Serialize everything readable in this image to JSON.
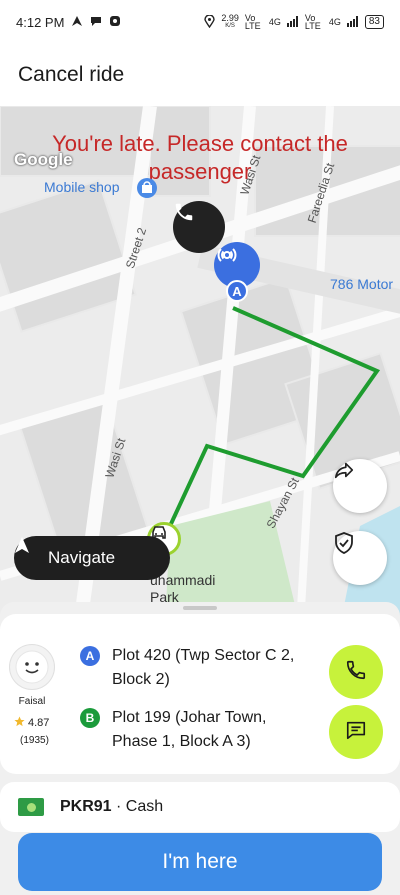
{
  "status_bar": {
    "time": "4:12 PM",
    "speed": "2.99",
    "speed_unit": "K/S",
    "sim1": "Vo LTE",
    "sim1_net": "4G",
    "sim2": "Vo LTE",
    "sim2_net": "4G",
    "battery": "83"
  },
  "header": {
    "title": "Cancel ride"
  },
  "map": {
    "banner": "You're late. Please contact the passenger",
    "google": "Google",
    "places": {
      "mobile_shop": "Mobile shop",
      "motor": "786 Motor",
      "park": "uhammadi Park"
    },
    "streets": {
      "wasi_top": "Wasi St",
      "fareedia": "Fareedia St",
      "street2": "Street 2",
      "wasi": "Wasi St",
      "shayan": "Shayan St"
    },
    "navigate_label": "Navigate",
    "pickup_badge": "A"
  },
  "ride": {
    "rider": {
      "name": "Faisal",
      "rating": "4.87",
      "trips": "(1935)"
    },
    "stops": [
      {
        "marker": "A",
        "address": "Plot 420 (Twp Sector C 2, Block 2)"
      },
      {
        "marker": "B",
        "address": "Plot 199 (Johar Town, Phase 1, Block A 3)"
      }
    ]
  },
  "payment": {
    "fare": "PKR91",
    "method": "· Cash"
  },
  "primary_button": "I'm here",
  "colors": {
    "accent_blue": "#3d8be6",
    "lime": "#c7f23b",
    "route_green": "#1e9c2f",
    "late_red": "#c62828"
  }
}
